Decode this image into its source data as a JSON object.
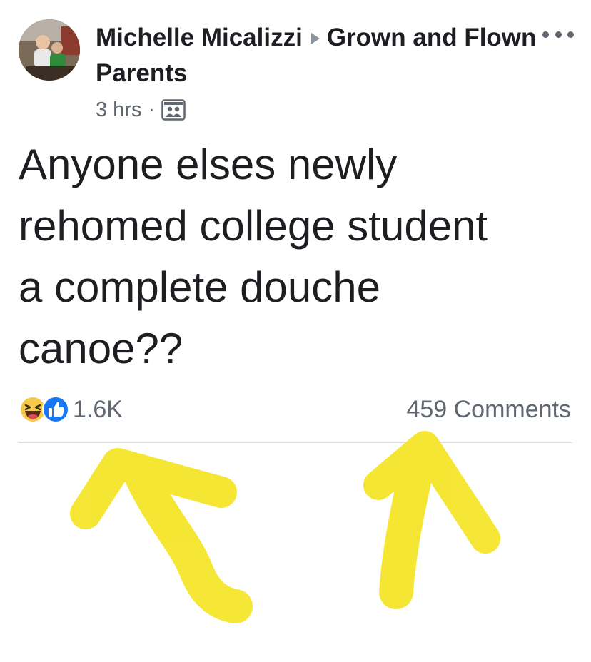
{
  "post": {
    "author": "Michelle Micalizzi",
    "group": "Grown and Flown Parents",
    "timestamp": "3 hrs",
    "separator": "·",
    "audience_icon": "group-audience-icon",
    "text": "Anyone elses newly\nrehomed college student\na complete douche\ncanoe??",
    "reactions": {
      "icons": [
        "haha-reaction-icon",
        "like-reaction-icon"
      ],
      "count": "1.6K"
    },
    "comments_label": "459 Comments"
  },
  "colors": {
    "text": "#1c1e21",
    "secondary": "#606770",
    "like_blue": "#1877f2",
    "haha_yellow": "#f7c94b",
    "highlighter": "#f5e52a"
  }
}
